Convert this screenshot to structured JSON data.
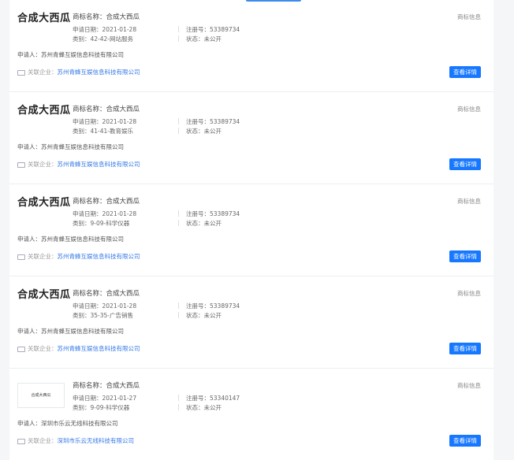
{
  "labels": {
    "trademark_name_prefix": "商标名称：",
    "apply_date_prefix": "申请日期：",
    "category_prefix": "类别：",
    "reg_no_prefix": "注册号：",
    "status_prefix": "状态：",
    "applicant_prefix": "申请人：",
    "related_prefix": "关联企业：",
    "corner_label": "商标信息",
    "detail_button": "查看详情"
  },
  "cards": [
    {
      "logo_text": "合成大西瓜",
      "logo_style": "bold",
      "trademark_name": "合成大西瓜",
      "apply_date": "2021-01-28",
      "category": "42-42-网站服务",
      "reg_no": "53389734",
      "status": "未公开",
      "applicant": "苏州青蜂互娱信息科技有限公司",
      "related_company": "苏州青蜂互娱信息科技有限公司"
    },
    {
      "logo_text": "合成大西瓜",
      "logo_style": "bold",
      "trademark_name": "合成大西瓜",
      "apply_date": "2021-01-28",
      "category": "41-41-教育娱乐",
      "reg_no": "53389734",
      "status": "未公开",
      "applicant": "苏州青蜂互娱信息科技有限公司",
      "related_company": "苏州青蜂互娱信息科技有限公司"
    },
    {
      "logo_text": "合成大西瓜",
      "logo_style": "bold",
      "trademark_name": "合成大西瓜",
      "apply_date": "2021-01-28",
      "category": "9-09-科学仪器",
      "reg_no": "53389734",
      "status": "未公开",
      "applicant": "苏州青蜂互娱信息科技有限公司",
      "related_company": "苏州青蜂互娱信息科技有限公司"
    },
    {
      "logo_text": "合成大西瓜",
      "logo_style": "bold",
      "trademark_name": "合成大西瓜",
      "apply_date": "2021-01-28",
      "category": "35-35-广告销售",
      "reg_no": "53389734",
      "status": "未公开",
      "applicant": "苏州青蜂互娱信息科技有限公司",
      "related_company": "苏州青蜂互娱信息科技有限公司"
    },
    {
      "logo_text": "合成大西瓜",
      "logo_style": "boxed",
      "trademark_name": "合成大西瓜",
      "apply_date": "2021-01-27",
      "category": "9-09-科学仪器",
      "reg_no": "53340147",
      "status": "未公开",
      "applicant": "深圳市乐云无线科技有限公司",
      "related_company": "深圳市乐云无线科技有限公司"
    }
  ],
  "colors": {
    "accent": "#1677ff",
    "link": "#3578e5",
    "page_bg": "#f5f6f8"
  },
  "icons": {
    "related_company": "link-icon"
  }
}
